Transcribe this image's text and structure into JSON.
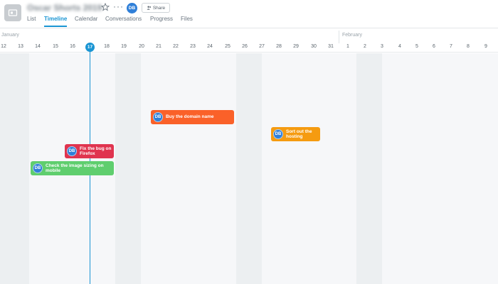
{
  "header": {
    "project_title": "Oscar Shorts 2019",
    "avatar_initials": "DB",
    "share_label": "Share",
    "more_label": "···"
  },
  "tabs": [
    {
      "label": "List",
      "active": false
    },
    {
      "label": "Timeline",
      "active": true
    },
    {
      "label": "Calendar",
      "active": false
    },
    {
      "label": "Conversations",
      "active": false
    },
    {
      "label": "Progress",
      "active": false
    },
    {
      "label": "Files",
      "active": false
    }
  ],
  "timeline": {
    "months": [
      {
        "label": "January"
      },
      {
        "label": "February"
      }
    ],
    "days": [
      "12",
      "13",
      "14",
      "15",
      "16",
      "17",
      "18",
      "19",
      "20",
      "21",
      "22",
      "23",
      "24",
      "25",
      "26",
      "27",
      "28",
      "29",
      "30",
      "31",
      "1",
      "2",
      "3",
      "4",
      "5",
      "6",
      "7",
      "8",
      "9"
    ],
    "today": "17"
  },
  "tasks": [
    {
      "title": "Buy the domain name",
      "initials": "DB",
      "color": "#fa6129"
    },
    {
      "title": "Sort out the hosting",
      "initials": "DB",
      "color": "#f59b10"
    },
    {
      "title": "Fix the bug on Firefox",
      "initials": "DB",
      "color": "#e0344f"
    },
    {
      "title": "Check the image sizing on mobile",
      "initials": "DB",
      "color": "#5fce6e"
    }
  ],
  "colors": {
    "accent": "#1a95d3",
    "avatar": "#2f7fd8"
  }
}
